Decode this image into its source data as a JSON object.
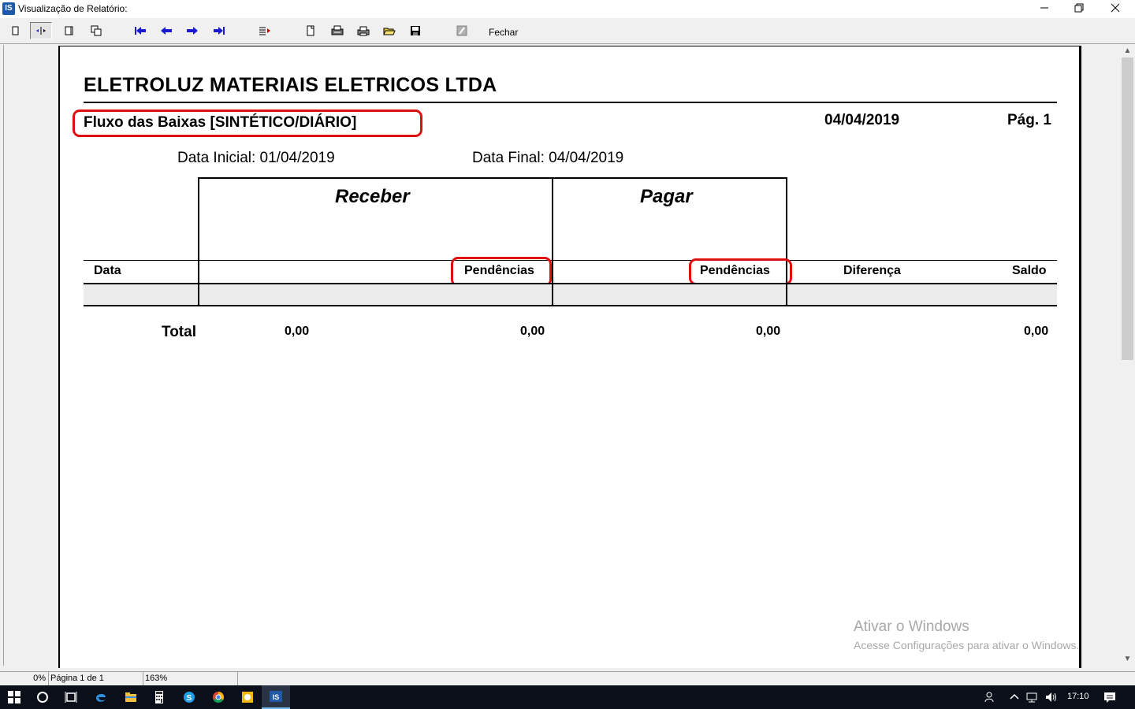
{
  "window": {
    "title": "Visualização de Relatório:",
    "app_icon_text": "IS",
    "minimize_icon": "minimize-icon",
    "maximize_icon": "restore-icon",
    "close_icon": "close-icon"
  },
  "toolbar": {
    "buttons": [
      "one-page-icon",
      "page-width-icon",
      "two-pages-icon",
      "multi-page-icon",
      "first-page-icon",
      "previous-page-icon",
      "next-page-icon",
      "last-page-icon",
      "go-to-page-icon",
      "page-setup-icon",
      "printer-setup-icon",
      "print-icon",
      "open-icon",
      "save-icon",
      "edit-icon"
    ],
    "close_label": "Fechar"
  },
  "report": {
    "company": "ELETROLUZ MATERIAIS ELETRICOS LTDA",
    "title": "Fluxo das Baixas [SINTÉTICO/DIÁRIO]",
    "date": "04/04/2019",
    "page": "Pág. 1",
    "initial_date": "Data Inicial: 01/04/2019",
    "final_date": "Data Final: 04/04/2019",
    "group_receber": "Receber",
    "group_pagar": "Pagar",
    "columns": [
      "Data",
      "Pendências",
      "Pendências",
      "Diferença",
      "Saldo"
    ],
    "total_label": "Total",
    "totals": [
      "0,00",
      "0,00",
      "0,00",
      "0,00"
    ],
    "highlight_color": "#e01010"
  },
  "watermark": {
    "line1": "Ativar o Windows",
    "line2": "Acesse Configurações para ativar o Windows."
  },
  "statusbar": {
    "progress": "0%",
    "page_info": "Página 1 de 1",
    "zoom": "163%"
  },
  "taskbar": {
    "items": [
      "windows-start-icon",
      "cortana-search-icon",
      "task-view-icon",
      "edge-icon",
      "file-explorer-icon",
      "calculator-icon",
      "skype-icon",
      "chrome-icon",
      "sticky-app-icon",
      "is-app-icon"
    ],
    "clock": "17:10"
  }
}
